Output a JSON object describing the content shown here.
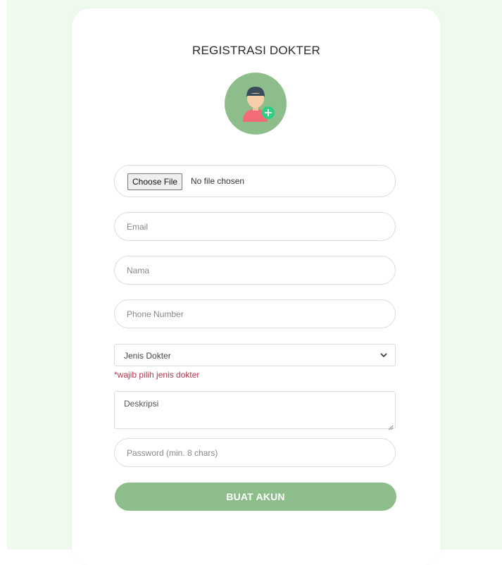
{
  "form": {
    "title": "REGISTRASI DOKTER",
    "avatar_icon": "doctor-add-user-icon",
    "file_button_label": "Choose File",
    "file_status": "No file chosen",
    "email_placeholder": "Email",
    "nama_placeholder": "Nama",
    "phone_placeholder": "Phone Number",
    "jenis_dokter_selected": "Jenis Dokter",
    "jenis_dokter_warning": "*wajib pilih jenis dokter",
    "deskripsi_placeholder": "Deskripsi",
    "password_placeholder": "Password (min. 8 chars)",
    "submit_label": "BUAT AKUN"
  },
  "colors": {
    "page_background": "#eefaee",
    "accent": "#8dbd8a",
    "warning": "#b3364a"
  }
}
